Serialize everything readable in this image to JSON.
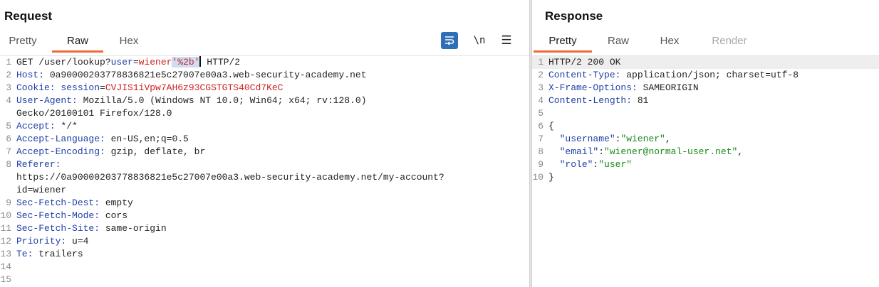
{
  "request": {
    "title": "Request",
    "tabs": [
      "Pretty",
      "Raw",
      "Hex"
    ],
    "active_tab": "Raw",
    "tools": {
      "newline_label": "\\n",
      "menu_label": "☰"
    },
    "lines": [
      {
        "n": "1",
        "parts": [
          [
            "GET /user/lookup?",
            "val"
          ],
          [
            "user",
            "param"
          ],
          [
            "=",
            "val"
          ],
          [
            "wiener",
            "str"
          ],
          [
            "'%2b'",
            "sel"
          ]
        ],
        "caret": true,
        "after": " HTTP/2"
      },
      {
        "n": "2",
        "parts": [
          [
            "Host:",
            "key"
          ],
          [
            " 0a90000203778836821e5c27007e00a3.web-security-academy.net",
            "val"
          ]
        ]
      },
      {
        "n": "3",
        "parts": [
          [
            "Cookie:",
            "key"
          ],
          [
            " session",
            "param"
          ],
          [
            "=",
            "val"
          ],
          [
            "CVJIS1iVpw7AH6z93CGSTGTS40Cd7KeC",
            "str"
          ]
        ]
      },
      {
        "n": "4",
        "parts": [
          [
            "User-Agent:",
            "key"
          ],
          [
            " Mozilla/5.0 (Windows NT 10.0; Win64; x64; rv:128.0)",
            "val"
          ]
        ]
      },
      {
        "n": "",
        "parts": [
          [
            "Gecko/20100101 Firefox/128.0",
            "val"
          ]
        ]
      },
      {
        "n": "5",
        "parts": [
          [
            "Accept:",
            "key"
          ],
          [
            " */*",
            "val"
          ]
        ]
      },
      {
        "n": "6",
        "parts": [
          [
            "Accept-Language:",
            "key"
          ],
          [
            " en-US,en;q=0.5",
            "val"
          ]
        ]
      },
      {
        "n": "7",
        "parts": [
          [
            "Accept-Encoding:",
            "key"
          ],
          [
            " gzip, deflate, br",
            "val"
          ]
        ]
      },
      {
        "n": "8",
        "parts": [
          [
            "Referer:",
            "key"
          ]
        ]
      },
      {
        "n": "",
        "parts": [
          [
            "https://0a90000203778836821e5c27007e00a3.web-security-academy.net/my-account?",
            "val"
          ]
        ]
      },
      {
        "n": "",
        "parts": [
          [
            "id=wiener",
            "val"
          ]
        ]
      },
      {
        "n": "9",
        "parts": [
          [
            "Sec-Fetch-Dest:",
            "key"
          ],
          [
            " empty",
            "val"
          ]
        ]
      },
      {
        "n": "10",
        "parts": [
          [
            "Sec-Fetch-Mode:",
            "key"
          ],
          [
            " cors",
            "val"
          ]
        ]
      },
      {
        "n": "11",
        "parts": [
          [
            "Sec-Fetch-Site:",
            "key"
          ],
          [
            " same-origin",
            "val"
          ]
        ]
      },
      {
        "n": "12",
        "parts": [
          [
            "Priority:",
            "key"
          ],
          [
            " u=4",
            "val"
          ]
        ]
      },
      {
        "n": "13",
        "parts": [
          [
            "Te:",
            "key"
          ],
          [
            " trailers",
            "val"
          ]
        ]
      },
      {
        "n": "14",
        "parts": []
      },
      {
        "n": "15",
        "parts": []
      }
    ]
  },
  "response": {
    "title": "Response",
    "tabs": [
      "Pretty",
      "Raw",
      "Hex",
      "Render"
    ],
    "active_tab": "Pretty",
    "disabled_tab": "Render",
    "lines": [
      {
        "n": "1",
        "hl": true,
        "parts": [
          [
            "HTTP/2 200 OK",
            "val"
          ]
        ]
      },
      {
        "n": "2",
        "parts": [
          [
            "Content-Type:",
            "key"
          ],
          [
            " application/json; charset=utf-8",
            "val"
          ]
        ]
      },
      {
        "n": "3",
        "parts": [
          [
            "X-Frame-Options:",
            "key"
          ],
          [
            " SAMEORIGIN",
            "val"
          ]
        ]
      },
      {
        "n": "4",
        "parts": [
          [
            "Content-Length:",
            "key"
          ],
          [
            " 81",
            "val"
          ]
        ]
      },
      {
        "n": "5",
        "parts": []
      },
      {
        "n": "6",
        "parts": [
          [
            "{",
            "val"
          ]
        ]
      },
      {
        "n": "7",
        "parts": [
          [
            "  ",
            "val"
          ],
          [
            "\"username\"",
            "jk"
          ],
          [
            ":",
            "val"
          ],
          [
            "\"wiener\"",
            "js"
          ],
          [
            ",",
            "val"
          ]
        ]
      },
      {
        "n": "8",
        "parts": [
          [
            "  ",
            "val"
          ],
          [
            "\"email\"",
            "jk"
          ],
          [
            ":",
            "val"
          ],
          [
            "\"wiener@normal-user.net\"",
            "js"
          ],
          [
            ",",
            "val"
          ]
        ]
      },
      {
        "n": "9",
        "parts": [
          [
            "  ",
            "val"
          ],
          [
            "\"role\"",
            "jk"
          ],
          [
            ":",
            "val"
          ],
          [
            "\"user\"",
            "js"
          ]
        ]
      },
      {
        "n": "10",
        "parts": [
          [
            "}",
            "val"
          ]
        ]
      }
    ]
  },
  "colors": {
    "accent_underline": "#f06a35",
    "header_key": "#1f3fa8",
    "string_value": "#cc2222",
    "json_string": "#1a8a1a",
    "selection": "#cfdcf2",
    "wrap_button": "#2e6fb5"
  }
}
